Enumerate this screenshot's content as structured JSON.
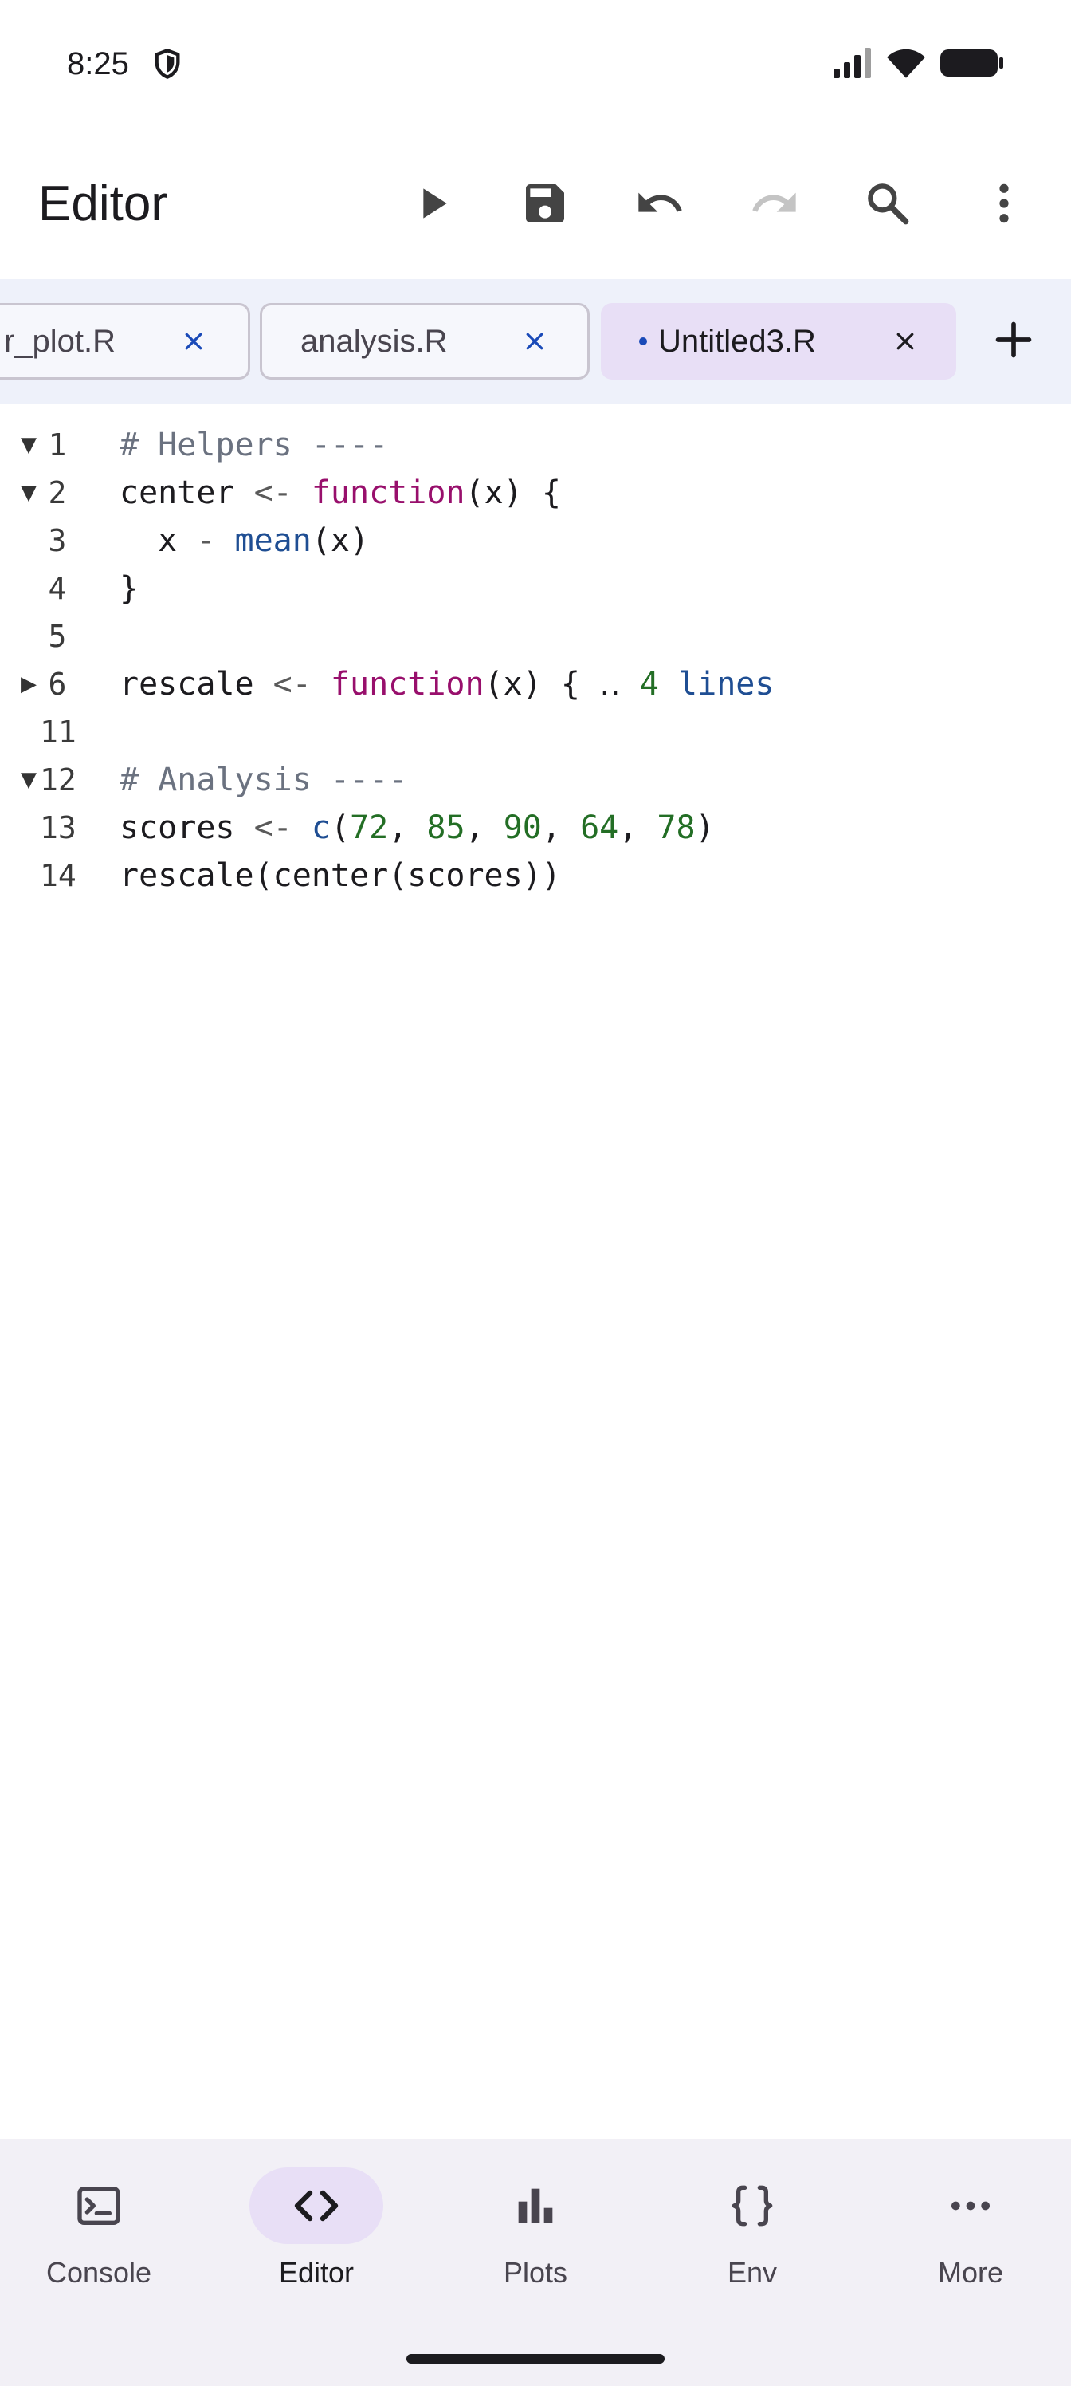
{
  "status_bar": {
    "time": "8:25",
    "icons": [
      "shield-icon",
      "signal-icon",
      "wifi-icon",
      "battery-icon"
    ]
  },
  "app_bar": {
    "title": "Editor",
    "actions": [
      "run-icon",
      "save-icon",
      "undo-icon",
      "redo-icon",
      "search-icon",
      "more-vert-icon"
    ],
    "redo_enabled": false
  },
  "tabs": [
    {
      "label": "r_plot.R",
      "modified": false,
      "active": false
    },
    {
      "label": "analysis.R",
      "modified": false,
      "active": false
    },
    {
      "label": "Untitled3.R",
      "modified": true,
      "active": true
    }
  ],
  "colors": {
    "accent": "#1a4ab8",
    "active_tab": "#e8dff6",
    "tab_strip": "#eef1fa",
    "keyword": "#980f6c",
    "builtin": "#1f4e93",
    "number": "#236e25",
    "comment": "#6b7280"
  },
  "editor": {
    "lines": [
      {
        "num": "1",
        "fold": "▼",
        "tokens": [
          {
            "t": "# Helpers ----",
            "c": "comment"
          }
        ]
      },
      {
        "num": "2",
        "fold": "▼",
        "tokens": [
          {
            "t": "center ",
            "c": ""
          },
          {
            "t": "<-",
            "c": "op"
          },
          {
            "t": " ",
            "c": ""
          },
          {
            "t": "function",
            "c": "keyword"
          },
          {
            "t": "(x) {",
            "c": ""
          }
        ]
      },
      {
        "num": "3",
        "fold": "",
        "tokens": [
          {
            "t": "  x ",
            "c": ""
          },
          {
            "t": "-",
            "c": "op"
          },
          {
            "t": " ",
            "c": ""
          },
          {
            "t": "mean",
            "c": "builtin"
          },
          {
            "t": "(x)",
            "c": ""
          }
        ]
      },
      {
        "num": "4",
        "fold": "",
        "tokens": [
          {
            "t": "}",
            "c": ""
          }
        ]
      },
      {
        "num": "5",
        "fold": "",
        "tokens": []
      },
      {
        "num": "6",
        "fold": "▶",
        "tokens": [
          {
            "t": "rescale ",
            "c": ""
          },
          {
            "t": "<-",
            "c": "op"
          },
          {
            "t": " ",
            "c": ""
          },
          {
            "t": "function",
            "c": "keyword"
          },
          {
            "t": "(x) { ",
            "c": ""
          },
          {
            "t": "‥",
            "c": ""
          },
          {
            "t": " ",
            "c": ""
          },
          {
            "t": "4",
            "c": "fold"
          },
          {
            "t": " lines",
            "c": "foldtxt"
          }
        ]
      },
      {
        "num": "11",
        "fold": "",
        "tokens": []
      },
      {
        "num": "12",
        "fold": "▼",
        "tokens": [
          {
            "t": "# Analysis ----",
            "c": "comment"
          }
        ]
      },
      {
        "num": "13",
        "fold": "",
        "tokens": [
          {
            "t": "scores ",
            "c": ""
          },
          {
            "t": "<-",
            "c": "op"
          },
          {
            "t": " ",
            "c": ""
          },
          {
            "t": "c",
            "c": "builtin"
          },
          {
            "t": "(",
            "c": ""
          },
          {
            "t": "72",
            "c": "number"
          },
          {
            "t": ", ",
            "c": ""
          },
          {
            "t": "85",
            "c": "number"
          },
          {
            "t": ", ",
            "c": ""
          },
          {
            "t": "90",
            "c": "number"
          },
          {
            "t": ", ",
            "c": ""
          },
          {
            "t": "64",
            "c": "number"
          },
          {
            "t": ", ",
            "c": ""
          },
          {
            "t": "78",
            "c": "number"
          },
          {
            "t": ")",
            "c": ""
          }
        ]
      },
      {
        "num": "14",
        "fold": "",
        "tokens": [
          {
            "t": "rescale(center(scores))",
            "c": ""
          }
        ]
      }
    ]
  },
  "bottom_nav": {
    "items": [
      {
        "label": "Console",
        "icon": "terminal-icon",
        "active": false
      },
      {
        "label": "Editor",
        "icon": "code-icon",
        "active": true
      },
      {
        "label": "Plots",
        "icon": "bar-chart-icon",
        "active": false
      },
      {
        "label": "Env",
        "icon": "braces-icon",
        "active": false
      },
      {
        "label": "More",
        "icon": "more-horiz-icon",
        "active": false
      }
    ]
  }
}
